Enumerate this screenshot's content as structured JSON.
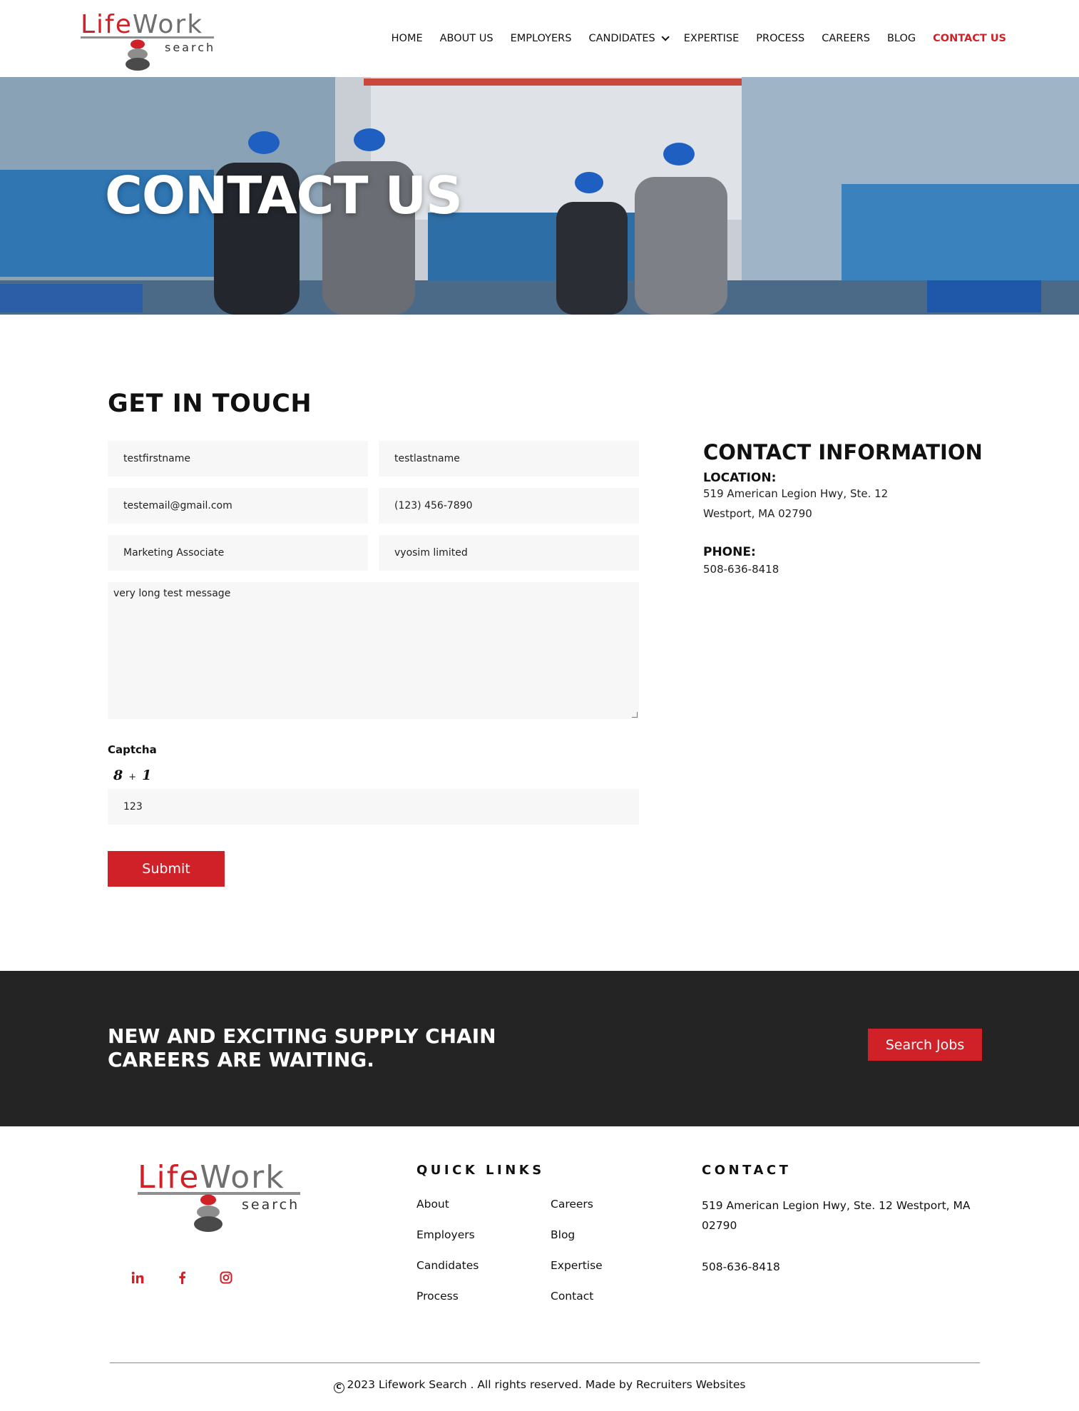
{
  "logo": {
    "word_life": "Life",
    "word_work": "Work",
    "tagline": "search"
  },
  "nav": {
    "items": [
      {
        "label": "HOME"
      },
      {
        "label": "ABOUT US"
      },
      {
        "label": "EMPLOYERS"
      },
      {
        "label": "CANDIDATES"
      },
      {
        "label": "EXPERTISE"
      },
      {
        "label": "PROCESS"
      },
      {
        "label": "CAREERS"
      },
      {
        "label": "BLOG"
      },
      {
        "label": "CONTACT US"
      }
    ],
    "active": "CONTACT US"
  },
  "hero": {
    "title": "CONTACT US"
  },
  "form": {
    "title": "GET IN TOUCH",
    "first_name": "testfirstname",
    "last_name": "testlastname",
    "email": "testemail@gmail.com",
    "phone": "(123) 456-7890",
    "job_title": "Marketing Associate",
    "company": "vyosim limited",
    "message": "very long test message",
    "captcha_label": "Captcha",
    "captcha_a": "8",
    "captcha_op": "+",
    "captcha_b": "1",
    "captcha_answer": "123",
    "submit_label": "Submit"
  },
  "contact_info": {
    "title": "CONTACT INFORMATION",
    "location_label": "LOCATION:",
    "address_line1": "519 American Legion Hwy, Ste. 12",
    "address_line2": "Westport, MA 02790",
    "phone_label": "PHONE:",
    "phone": "508-636-8418"
  },
  "cta": {
    "line1": "NEW AND EXCITING SUPPLY CHAIN",
    "line2": "CAREERS ARE WAITING.",
    "button_label": "Search Jobs"
  },
  "footer": {
    "quick_links_title": "QUICK LINKS",
    "links_col1": [
      "About",
      "Employers",
      "Candidates",
      "Process"
    ],
    "links_col2": [
      "Careers",
      "Blog",
      "Expertise",
      "Contact"
    ],
    "contact_title": "CONTACT",
    "address_line1": "519 American Legion Hwy, Ste. 12 Westport, MA",
    "address_line2": "02790",
    "phone": "508-636-8418",
    "social": [
      "linkedin-icon",
      "facebook-icon",
      "instagram-icon"
    ],
    "copyright": "2023 Lifework Search . All rights reserved. Made by Recruiters Websites"
  },
  "colors": {
    "accent": "#d12128",
    "dark_band": "#242424",
    "field_bg": "#f7f7f7"
  }
}
